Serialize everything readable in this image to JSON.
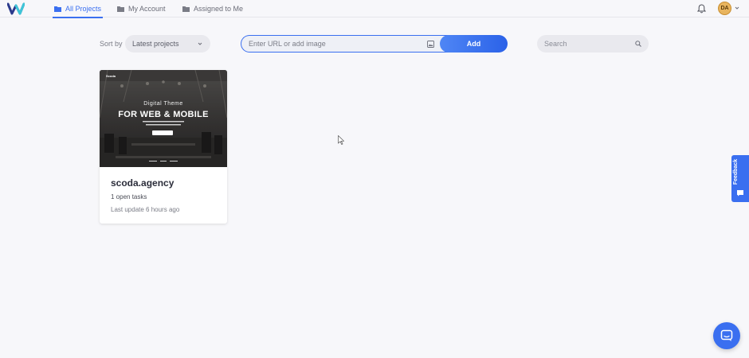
{
  "nav": {
    "tabs": [
      {
        "label": "All Projects",
        "icon": "folder-icon",
        "active": true
      },
      {
        "label": "My Account",
        "icon": "folder-icon",
        "active": false
      },
      {
        "label": "Assigned to Me",
        "icon": "folder-icon",
        "active": false
      }
    ],
    "avatar_initials": "DA"
  },
  "toolbar": {
    "sort_label": "Sort by",
    "sort_value": "Latest projects",
    "url_placeholder": "Enter URL or add image",
    "add_label": "Add",
    "search_placeholder": "Search"
  },
  "projects": [
    {
      "name": "scoda.agency",
      "tasks": "1 open tasks",
      "updated": "Last update 6 hours ago",
      "thumbnail": {
        "brand": "Scoda",
        "line1": "Digital Theme",
        "line2": "FOR WEB & MOBILE"
      }
    }
  ],
  "feedback_label": "Feedback",
  "colors": {
    "accent": "#3a6ff0",
    "background": "#f7f7fa",
    "avatar": "#e8b45e"
  }
}
